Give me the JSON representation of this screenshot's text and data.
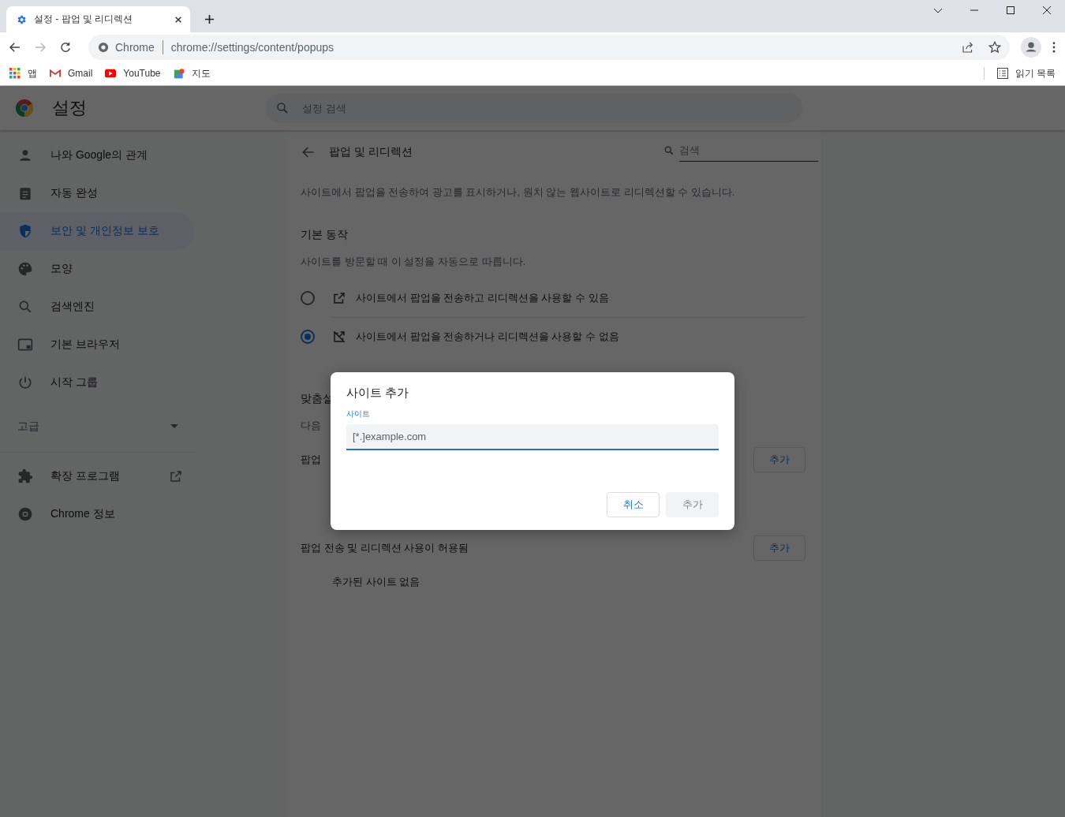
{
  "browser": {
    "tab": {
      "title": "설정 - 팝업 및 리디렉션"
    },
    "address": {
      "origin": "Chrome",
      "url": "chrome://settings/content/popups"
    },
    "bookmarks": [
      {
        "label": "앱"
      },
      {
        "label": "Gmail"
      },
      {
        "label": "YouTube"
      },
      {
        "label": "지도"
      }
    ],
    "reading_list": "읽기 목록"
  },
  "settings": {
    "title": "설정",
    "search": {
      "placeholder": "설정 검색"
    }
  },
  "sidebar": {
    "items": [
      {
        "label": "나와 Google의 관계",
        "selected": false
      },
      {
        "label": "자동 완성",
        "selected": false
      },
      {
        "label": "보안 및 개인정보 보호",
        "selected": true
      },
      {
        "label": "모양",
        "selected": false
      },
      {
        "label": "검색엔진",
        "selected": false
      },
      {
        "label": "기본 브라우저",
        "selected": false
      },
      {
        "label": "시작 그룹",
        "selected": false
      }
    ],
    "advanced": "고급",
    "extras": [
      {
        "label": "확장 프로그램"
      },
      {
        "label": "Chrome 정보"
      }
    ]
  },
  "content": {
    "title": "팝업 및 리디렉션",
    "search": {
      "placeholder": "검색"
    },
    "description": "사이트에서 팝업을 전송하여 광고를 표시하거나, 원치 않는 웹사이트로 리디렉션할 수 있습니다.",
    "default_heading": "기본 동작",
    "default_hint": "사이트를 방문할 때 이 설정을 자동으로 따릅니다.",
    "options": [
      {
        "label": "사이트에서 팝업을 전송하고 리디렉션을 사용할 수 있음",
        "selected": false
      },
      {
        "label": "사이트에서 팝업을 전송하거나 리디렉션을 사용할 수 없음",
        "selected": true
      }
    ],
    "custom_heading": "맞춤설",
    "custom_hint": "다음",
    "blocked_heading": "팝업",
    "blocked_add": "추가",
    "allowed_heading": "팝업 전송 및 리디렉션 사용이 허용됨",
    "allowed_add": "추가",
    "allowed_empty": "추가된 사이트 없음"
  },
  "dialog": {
    "title": "사이트 추가",
    "field_label": "사이트",
    "placeholder": "[*.]example.com",
    "buttons": [
      {
        "label": "취소",
        "disabled": false
      },
      {
        "label": "추가",
        "disabled": true
      }
    ]
  }
}
